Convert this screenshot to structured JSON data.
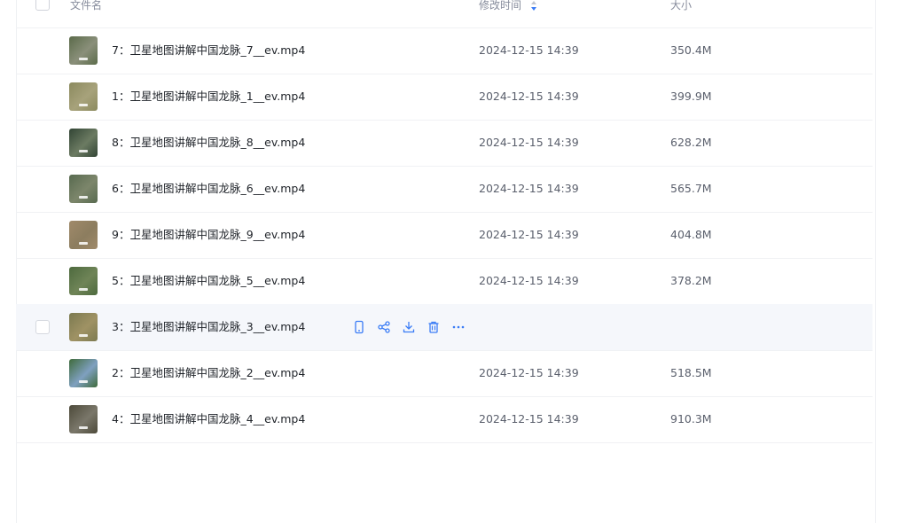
{
  "header": {
    "name_label": "文件名",
    "time_label": "修改时间",
    "size_label": "大小"
  },
  "colors": {
    "accent": "#3a7cf6",
    "hover_row": "#f5f7fb"
  },
  "rows": [
    {
      "name": "7：卫星地图讲解中国龙脉_7__ev.mp4",
      "time": "2024-12-15 14:39",
      "size": "350.4M",
      "thumb": [
        "#5b6b4a",
        "#8a8f7a"
      ]
    },
    {
      "name": "1：卫星地图讲解中国龙脉_1__ev.mp4",
      "time": "2024-12-15 14:39",
      "size": "399.9M",
      "thumb": [
        "#8b8a5e",
        "#a7a27b"
      ]
    },
    {
      "name": "8：卫星地图讲解中国龙脉_8__ev.mp4",
      "time": "2024-12-15 14:39",
      "size": "628.2M",
      "thumb": [
        "#324535",
        "#6c7b62"
      ]
    },
    {
      "name": "6：卫星地图讲解中国龙脉_6__ev.mp4",
      "time": "2024-12-15 14:39",
      "size": "565.7M",
      "thumb": [
        "#586a4f",
        "#7c866b"
      ]
    },
    {
      "name": "9：卫星地图讲解中国龙脉_9__ev.mp4",
      "time": "2024-12-15 14:39",
      "size": "404.8M",
      "thumb": [
        "#a08a6a",
        "#8c7d5f"
      ]
    },
    {
      "name": "5：卫星地图讲解中国龙脉_5__ev.mp4",
      "time": "2024-12-15 14:39",
      "size": "378.2M",
      "thumb": [
        "#4d6a3e",
        "#6f8457"
      ]
    },
    {
      "name": "3：卫星地图讲解中国龙脉_3__ev.mp4",
      "time": "",
      "size": "",
      "thumb": [
        "#7c7a50",
        "#9f9264"
      ],
      "hover": true
    },
    {
      "name": "2：卫星地图讲解中国龙脉_2__ev.mp4",
      "time": "2024-12-15 14:39",
      "size": "518.5M",
      "thumb": [
        "#3f6b3b",
        "#7fa0c0"
      ]
    },
    {
      "name": "4：卫星地图讲解中国龙脉_4__ev.mp4",
      "time": "2024-12-15 14:39",
      "size": "910.3M",
      "thumb": [
        "#4d4a3a",
        "#7a776a"
      ]
    }
  ],
  "row_actions": [
    "phone-icon",
    "share-icon",
    "download-icon",
    "delete-icon",
    "more-icon"
  ]
}
